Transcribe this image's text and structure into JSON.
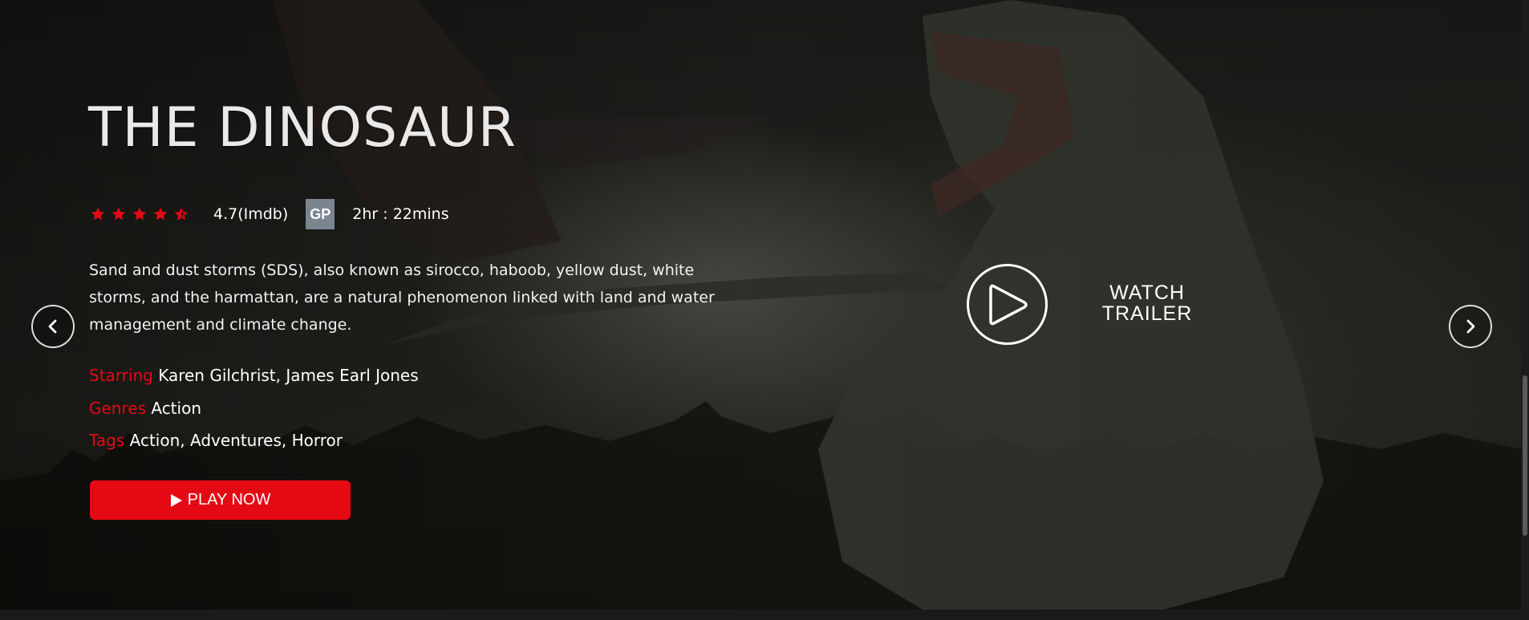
{
  "movie": {
    "title": "THE DINOSAUR",
    "rating_stars": 4.5,
    "rating_text": "4.7(Imdb)",
    "badge": "GP",
    "duration": "2hr : 22mins",
    "description": "Sand and dust storms (SDS), also known as sirocco, haboob, yellow dust, white storms, and the harmattan, are a natural phenomenon linked with land and water management and climate change.",
    "starring_label": "Starring",
    "starring_value": "Karen Gilchrist, James Earl Jones",
    "genres_label": "Genres",
    "genres_value": "Action",
    "tags_label": "Tags",
    "tags_value": "Action, Adventures, Horror"
  },
  "actions": {
    "play_label": "PLAY NOW",
    "trailer_label_line1": "WATCH",
    "trailer_label_line2": "TRAILER"
  },
  "icons": {
    "star": "star-icon",
    "play": "play-icon",
    "prev": "chevron-left-icon",
    "next": "chevron-right-icon",
    "trailer": "play-circle-icon"
  },
  "colors": {
    "accent": "#e50914",
    "badge_bg": "#7b8590",
    "text": "#ffffff"
  }
}
